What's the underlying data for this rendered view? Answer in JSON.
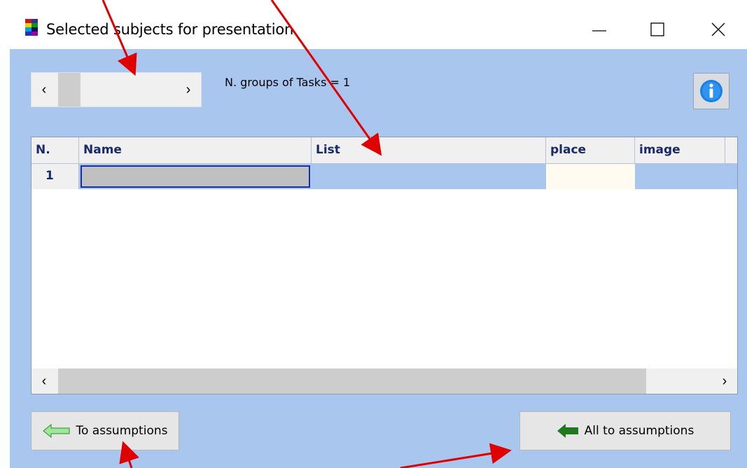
{
  "window": {
    "title": "Selected subjects for presentation"
  },
  "header": {
    "groups_label": "N. groups of Tasks = 1",
    "nav_left_glyph": "‹",
    "nav_right_glyph": "›"
  },
  "table": {
    "columns": [
      "N.",
      "Name",
      "List",
      "place",
      "image"
    ],
    "rows": [
      {
        "n": "1",
        "name": "",
        "list": "",
        "place": "",
        "image": ""
      }
    ],
    "hscroll_left_glyph": "‹",
    "hscroll_right_glyph": "›"
  },
  "buttons": {
    "to_assumptions": "To assumptions",
    "all_to_assumptions": "All to assumptions"
  },
  "colors": {
    "window_bg": "#a9c7ee",
    "annotation_arrow": "#e00000",
    "arrow_light_green": "#9be89b",
    "arrow_dark_green": "#1f7a1f"
  },
  "icons": {
    "app": "app-logo-icon",
    "info": "info-icon",
    "minimize": "minimize-icon",
    "maximize": "maximize-icon",
    "close": "close-icon"
  }
}
